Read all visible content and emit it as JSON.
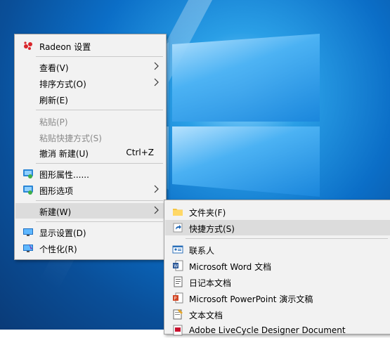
{
  "main_menu": {
    "items": [
      {
        "label": "Radeon 设置"
      },
      {
        "label": "查看(V)"
      },
      {
        "label": "排序方式(O)"
      },
      {
        "label": "刷新(E)"
      },
      {
        "label": "粘贴(P)"
      },
      {
        "label": "粘贴快捷方式(S)"
      },
      {
        "label": "撤消 新建(U)",
        "shortcut": "Ctrl+Z"
      },
      {
        "label": "图形属性......"
      },
      {
        "label": "图形选项"
      },
      {
        "label": "新建(W)"
      },
      {
        "label": "显示设置(D)"
      },
      {
        "label": "个性化(R)"
      }
    ]
  },
  "submenu": {
    "items": [
      {
        "label": "文件夹(F)"
      },
      {
        "label": "快捷方式(S)"
      },
      {
        "label": "联系人"
      },
      {
        "label": "Microsoft Word 文档"
      },
      {
        "label": "日记本文档"
      },
      {
        "label": "Microsoft PowerPoint 演示文稿"
      },
      {
        "label": "文本文档"
      },
      {
        "label": "Adobe LiveCycle Designer Document"
      }
    ]
  },
  "colors": {
    "menu_bg": "#f2f2f2",
    "highlight": "#dcdcdc",
    "disabled_text": "#8a8a8a",
    "radeon_red": "#d9262c"
  }
}
